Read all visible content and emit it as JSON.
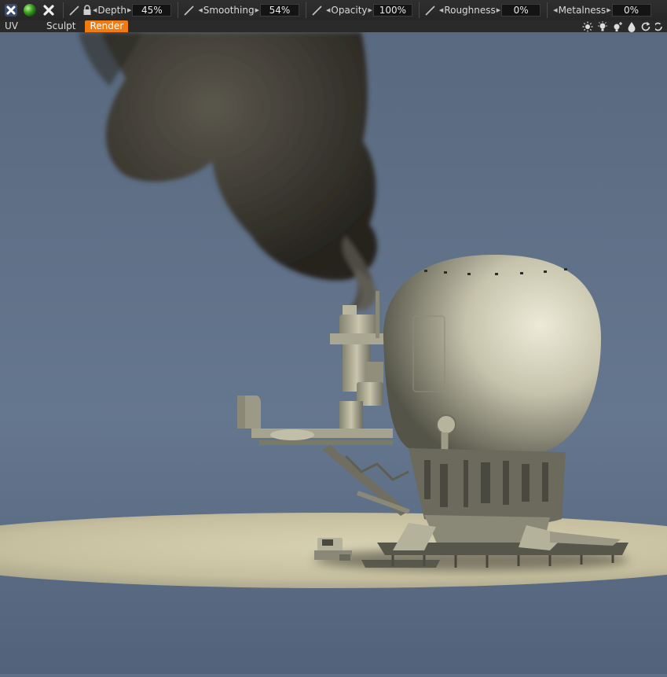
{
  "toolbar": {
    "icons": [
      "close-x-icon",
      "material-sphere-icon",
      "close-x-icon"
    ],
    "params": [
      {
        "name": "Depth",
        "value": "45%",
        "locked": true
      },
      {
        "name": "Smoothing",
        "value": "54%"
      },
      {
        "name": "Opacity",
        "value": "100%"
      },
      {
        "name": "Roughness",
        "value": "0%"
      },
      {
        "name": "Metalness",
        "value": "0%"
      }
    ]
  },
  "tabs": [
    {
      "label": "UV",
      "active": false
    },
    {
      "label": "Sculpt",
      "active": false
    },
    {
      "label": "Render",
      "active": true
    }
  ],
  "view_icons": [
    "sun-icon",
    "bulb-icon",
    "bulb-plus-icon",
    "drop-icon",
    "rotate-icon",
    "rotate-icon"
  ],
  "colors": {
    "accent": "#f07b12",
    "background": "#5e7088",
    "model": "#c9c5b0"
  }
}
